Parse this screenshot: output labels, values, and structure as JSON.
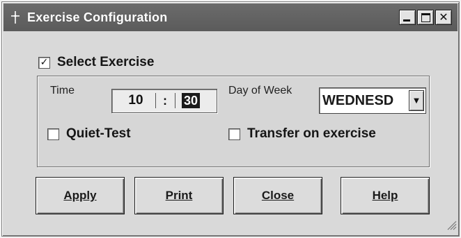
{
  "window": {
    "title": "Exercise Configuration",
    "icon": "crosshair-icon"
  },
  "title_controls": {
    "minimize": "minimize-icon",
    "maximize": "maximize-icon",
    "close": "close-icon"
  },
  "select_exercise": {
    "label": "Select Exercise",
    "checked": true,
    "mark": "✓"
  },
  "time": {
    "label": "Time",
    "hour": "10",
    "separator": ":",
    "minute": "30"
  },
  "day_of_week": {
    "label": "Day of Week",
    "value": "WEDNESD",
    "arrow": "▼"
  },
  "quiet_test": {
    "label": "Quiet-Test",
    "checked": false
  },
  "transfer": {
    "label": "Transfer on exercise",
    "checked": false
  },
  "buttons": {
    "apply": "Apply",
    "print": "Print",
    "close": "Close",
    "help": "Help"
  },
  "colors": {
    "titlebar": "#5f5f5f",
    "dialog": "#d9d9d9",
    "selected_minute": "#1b1b1b"
  }
}
